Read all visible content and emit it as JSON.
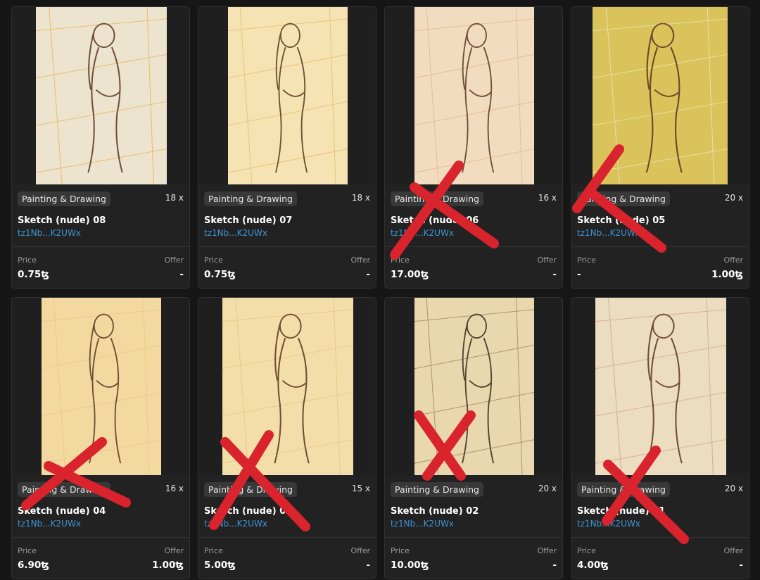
{
  "listings": [
    {
      "category": "Painting & Drawing",
      "count": "18 x",
      "title": "Sketch (nude) 08",
      "owner": "tz1Nb...K2UWx",
      "price_label": "Price",
      "price": "0.75ꜩ",
      "offer_label": "Offer",
      "offer": "-",
      "crossed": false,
      "art_bg": "#ece4cf",
      "art_accent": "#e6a92b"
    },
    {
      "category": "Painting & Drawing",
      "count": "18 x",
      "title": "Sketch (nude) 07",
      "owner": "tz1Nb...K2UWx",
      "price_label": "Price",
      "price": "0.75ꜩ",
      "offer_label": "Offer",
      "offer": "-",
      "crossed": false,
      "art_bg": "#f5e3b3",
      "art_accent": "#e3b04e"
    },
    {
      "category": "Painting & Drawing",
      "count": "16 x",
      "title": "Sketch (nude) 06",
      "owner": "tz1Nb...K2UWx",
      "price_label": "Price",
      "price": "17.00ꜩ",
      "offer_label": "Offer",
      "offer": "-",
      "crossed": true,
      "art_bg": "#f2dcc0",
      "art_accent": "#d9a97a"
    },
    {
      "category": "Painting & Drawing",
      "count": "20 x",
      "title": "Sketch (nude) 05",
      "owner": "tz1Nb...K2UWx",
      "price_label": "Price",
      "price": "-",
      "offer_label": "Offer",
      "offer": "1.00ꜩ",
      "crossed": true,
      "art_bg": "#d9c35a",
      "art_accent": "#f4efcf"
    },
    {
      "category": "Painting & Drawing",
      "count": "16 x",
      "title": "Sketch (nude) 04",
      "owner": "tz1Nb...K2UWx",
      "price_label": "Price",
      "price": "6.90ꜩ",
      "offer_label": "Offer",
      "offer": "1.00ꜩ",
      "crossed": true,
      "art_bg": "#f2d9a0",
      "art_accent": "#e7c27a"
    },
    {
      "category": "Painting & Drawing",
      "count": "15 x",
      "title": "Sketch (nude) 03",
      "owner": "tz1Nb...K2UWx",
      "price_label": "Price",
      "price": "5.00ꜩ",
      "offer_label": "Offer",
      "offer": "-",
      "crossed": true,
      "art_bg": "#f3deaa",
      "art_accent": "#e0c07a"
    },
    {
      "category": "Painting & Drawing",
      "count": "20 x",
      "title": "Sketch (nude) 02",
      "owner": "tz1Nb...K2UWx",
      "price_label": "Price",
      "price": "10.00ꜩ",
      "offer_label": "Offer",
      "offer": "-",
      "crossed": true,
      "art_bg": "#e9d7ad",
      "art_accent": "#8a6a45"
    },
    {
      "category": "Painting & Drawing",
      "count": "20 x",
      "title": "Sketch (nude) 01",
      "owner": "tz1Nb...K2UWx",
      "price_label": "Price",
      "price": "4.00ꜩ",
      "offer_label": "Offer",
      "offer": "-",
      "crossed": true,
      "art_bg": "#ecdcc0",
      "art_accent": "#c89a7a"
    }
  ],
  "colors": {
    "cross": "#d9232d",
    "link": "#3d94d6"
  }
}
